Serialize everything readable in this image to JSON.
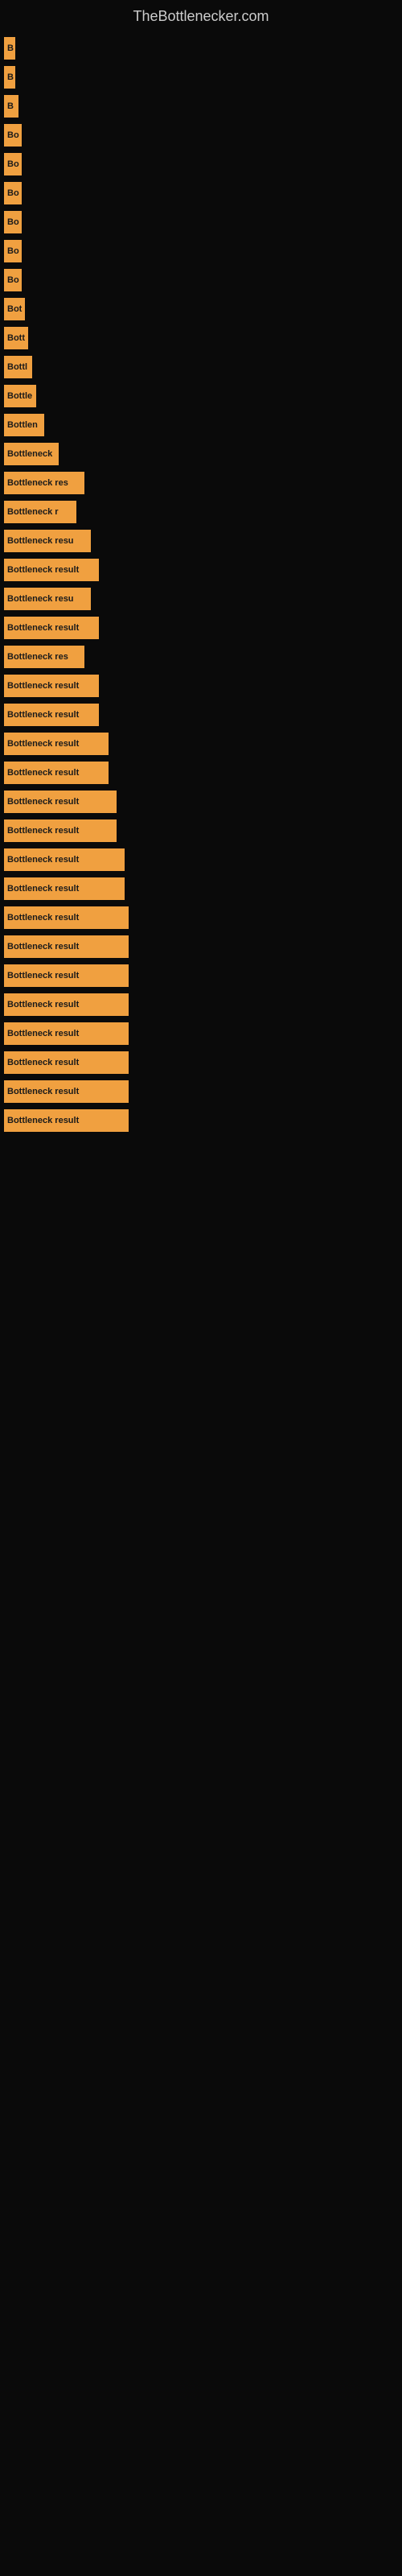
{
  "site": {
    "title": "TheBottlenecker.com"
  },
  "bars": [
    {
      "label": "B",
      "width": 14
    },
    {
      "label": "B",
      "width": 14
    },
    {
      "label": "B",
      "width": 18
    },
    {
      "label": "Bo",
      "width": 22
    },
    {
      "label": "Bo",
      "width": 22
    },
    {
      "label": "Bo",
      "width": 22
    },
    {
      "label": "Bo",
      "width": 22
    },
    {
      "label": "Bo",
      "width": 22
    },
    {
      "label": "Bo",
      "width": 22
    },
    {
      "label": "Bot",
      "width": 26
    },
    {
      "label": "Bott",
      "width": 30
    },
    {
      "label": "Bottl",
      "width": 35
    },
    {
      "label": "Bottle",
      "width": 40
    },
    {
      "label": "Bottlen",
      "width": 50
    },
    {
      "label": "Bottleneck",
      "width": 68
    },
    {
      "label": "Bottleneck res",
      "width": 100
    },
    {
      "label": "Bottleneck r",
      "width": 90
    },
    {
      "label": "Bottleneck resu",
      "width": 108
    },
    {
      "label": "Bottleneck result",
      "width": 118
    },
    {
      "label": "Bottleneck resu",
      "width": 108
    },
    {
      "label": "Bottleneck result",
      "width": 118
    },
    {
      "label": "Bottleneck res",
      "width": 100
    },
    {
      "label": "Bottleneck result",
      "width": 118
    },
    {
      "label": "Bottleneck result",
      "width": 118
    },
    {
      "label": "Bottleneck result",
      "width": 130
    },
    {
      "label": "Bottleneck result",
      "width": 130
    },
    {
      "label": "Bottleneck result",
      "width": 140
    },
    {
      "label": "Bottleneck result",
      "width": 140
    },
    {
      "label": "Bottleneck result",
      "width": 150
    },
    {
      "label": "Bottleneck result",
      "width": 150
    },
    {
      "label": "Bottleneck result",
      "width": 155
    },
    {
      "label": "Bottleneck result",
      "width": 155
    },
    {
      "label": "Bottleneck result",
      "width": 155
    },
    {
      "label": "Bottleneck result",
      "width": 155
    },
    {
      "label": "Bottleneck result",
      "width": 155
    },
    {
      "label": "Bottleneck result",
      "width": 155
    },
    {
      "label": "Bottleneck result",
      "width": 155
    },
    {
      "label": "Bottleneck result",
      "width": 155
    }
  ]
}
